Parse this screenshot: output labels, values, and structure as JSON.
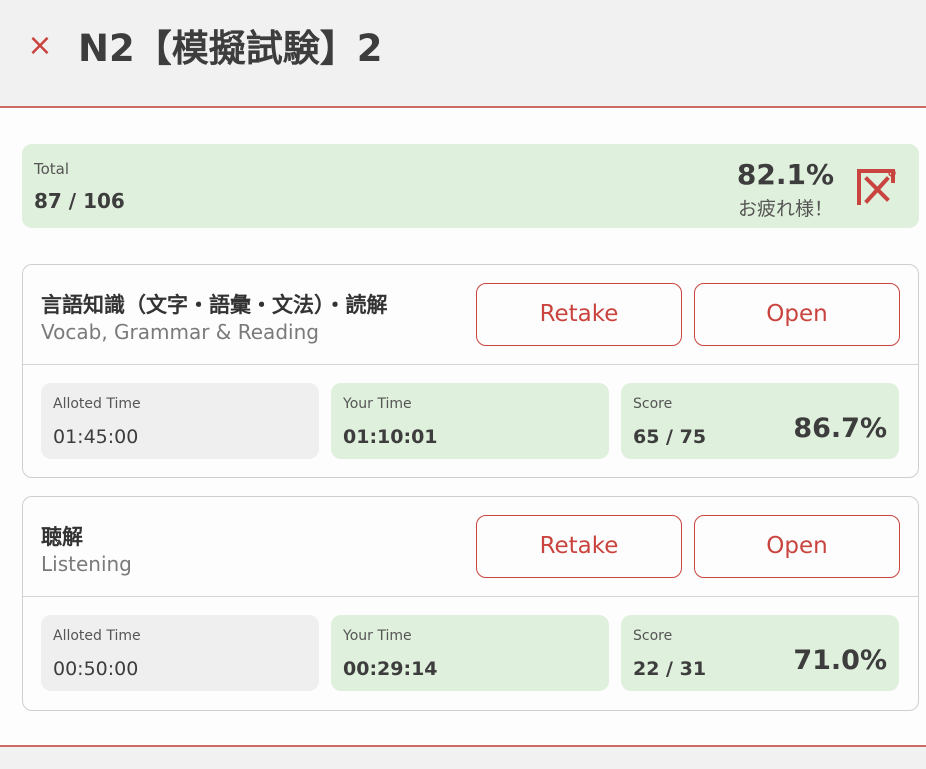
{
  "header": {
    "close_icon": "×",
    "title": "N2【模擬試験】2"
  },
  "summary": {
    "label": "Total",
    "value": "87 / 106",
    "percent": "82.1%",
    "message": "お疲れ様！",
    "stamp_icon": "stamp-icon",
    "accent_color": "#c9443f",
    "highlight_bg": "#dff0dc"
  },
  "sections": [
    {
      "title_jp": "言語知識（文字・語彙・文法）・読解",
      "title_en": "Vocab, Grammar & Reading",
      "retake_label": "Retake",
      "open_label": "Open",
      "alloted_label": "Alloted Time",
      "alloted_value": "01:45:00",
      "your_time_label": "Your Time",
      "your_time_value": "01:10:01",
      "score_label": "Score",
      "score_value": "65 / 75",
      "score_percent": "86.7%"
    },
    {
      "title_jp": "聴解",
      "title_en": "Listening",
      "retake_label": "Retake",
      "open_label": "Open",
      "alloted_label": "Alloted Time",
      "alloted_value": "00:50:00",
      "your_time_label": "Your Time",
      "your_time_value": "00:29:14",
      "score_label": "Score",
      "score_value": "22 / 31",
      "score_percent": "71.0%"
    }
  ]
}
